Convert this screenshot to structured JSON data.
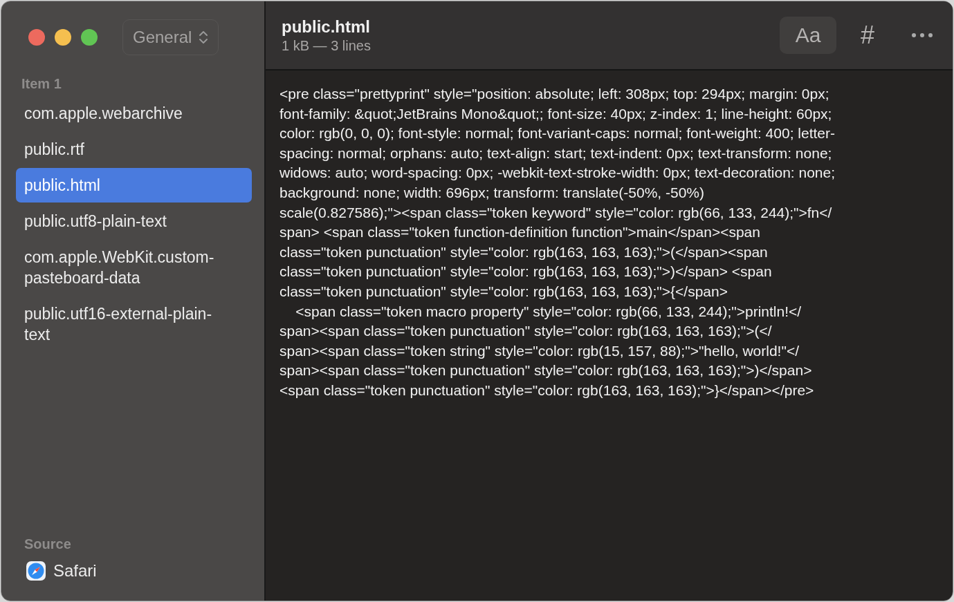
{
  "view_selector": {
    "label": "General"
  },
  "sidebar": {
    "section_title": "Item 1",
    "items": [
      {
        "label": "com.apple.webarchive",
        "selected": false
      },
      {
        "label": "public.rtf",
        "selected": false
      },
      {
        "label": "public.html",
        "selected": true
      },
      {
        "label": "public.utf8-plain-text",
        "selected": false
      },
      {
        "label": "com.apple.WebKit.custom-pasteboard-data",
        "selected": false
      },
      {
        "label": "public.utf16-external-plain-text",
        "selected": false
      }
    ],
    "source_title": "Source",
    "source_app": "Safari"
  },
  "header": {
    "title": "public.html",
    "subtitle": "1 kB — 3 lines",
    "font_button": "Aa",
    "number_button": "#"
  },
  "content_lines": [
    "<pre class=\"prettyprint\" style=\"position: absolute; left: 308px; top: 294px; margin: 0px;",
    "font-family: &quot;JetBrains Mono&quot;; font-size: 40px; z-index: 1; line-height: 60px;",
    "color: rgb(0, 0, 0); font-style: normal; font-variant-caps: normal; font-weight: 400; letter-",
    "spacing: normal; orphans: auto; text-align: start; text-indent: 0px; text-transform: none;",
    "widows: auto; word-spacing: 0px; -webkit-text-stroke-width: 0px; text-decoration: none;",
    "background: none; width: 696px; transform: translate(-50%, -50%)",
    "scale(0.827586);\"><span class=\"token keyword\" style=\"color: rgb(66, 133, 244);\">fn</",
    "span> <span class=\"token function-definition function\">main</span><span",
    "class=\"token punctuation\" style=\"color: rgb(163, 163, 163);\">(</span><span",
    "class=\"token punctuation\" style=\"color: rgb(163, 163, 163);\">)</span> <span",
    "class=\"token punctuation\" style=\"color: rgb(163, 163, 163);\">{</span>",
    "    <span class=\"token macro property\" style=\"color: rgb(66, 133, 244);\">println!</",
    "span><span class=\"token punctuation\" style=\"color: rgb(163, 163, 163);\">(</",
    "span><span class=\"token string\" style=\"color: rgb(15, 157, 88);\">\"hello, world!\"</",
    "span><span class=\"token punctuation\" style=\"color: rgb(163, 163, 163);\">)</span>",
    "<span class=\"token punctuation\" style=\"color: rgb(163, 163, 163);\">}</span></pre>"
  ]
}
